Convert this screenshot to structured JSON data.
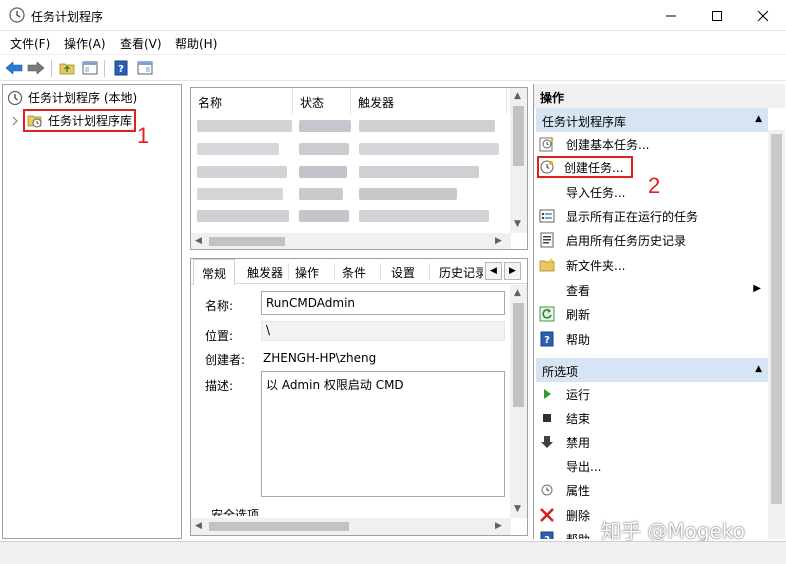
{
  "window": {
    "title": "任务计划程序",
    "controls": [
      "minimize",
      "maximize",
      "close"
    ]
  },
  "menu": [
    "文件(F)",
    "操作(A)",
    "查看(V)",
    "帮助(H)"
  ],
  "tree": {
    "root": "任务计划程序 (本地)",
    "child": "任务计划程序库",
    "annotation": "1"
  },
  "task_list": {
    "columns": [
      "名称",
      "状态",
      "触发器"
    ],
    "rows_blurred": true
  },
  "detail": {
    "tabs": [
      "常规",
      "触发器",
      "操作",
      "条件",
      "设置",
      "历史记录"
    ],
    "fields": {
      "name_label": "名称:",
      "name_value": "RunCMDAdmin",
      "location_label": "位置:",
      "location_value": "\\",
      "author_label": "创建者:",
      "author_value": "ZHENGH-HP\\zheng",
      "desc_label": "描述:",
      "desc_value": "以 Admin 权限启动 CMD",
      "security_label": "安全选项"
    }
  },
  "actions": {
    "header": "操作",
    "library_section": {
      "title": "任务计划程序库",
      "items": [
        "创建基本任务...",
        "创建任务...",
        "导入任务...",
        "显示所有正在运行的任务",
        "启用所有任务历史记录",
        "新文件夹...",
        "查看",
        "刷新",
        "帮助"
      ]
    },
    "annotation": "2",
    "selected_section": {
      "title": "所选项",
      "items": [
        "运行",
        "结束",
        "禁用",
        "导出...",
        "属性",
        "删除",
        "帮助"
      ]
    }
  },
  "watermark": "知乎 @Mogeko",
  "colors": {
    "annotation": "#e02020",
    "section_bg": "#d7e4f3"
  }
}
